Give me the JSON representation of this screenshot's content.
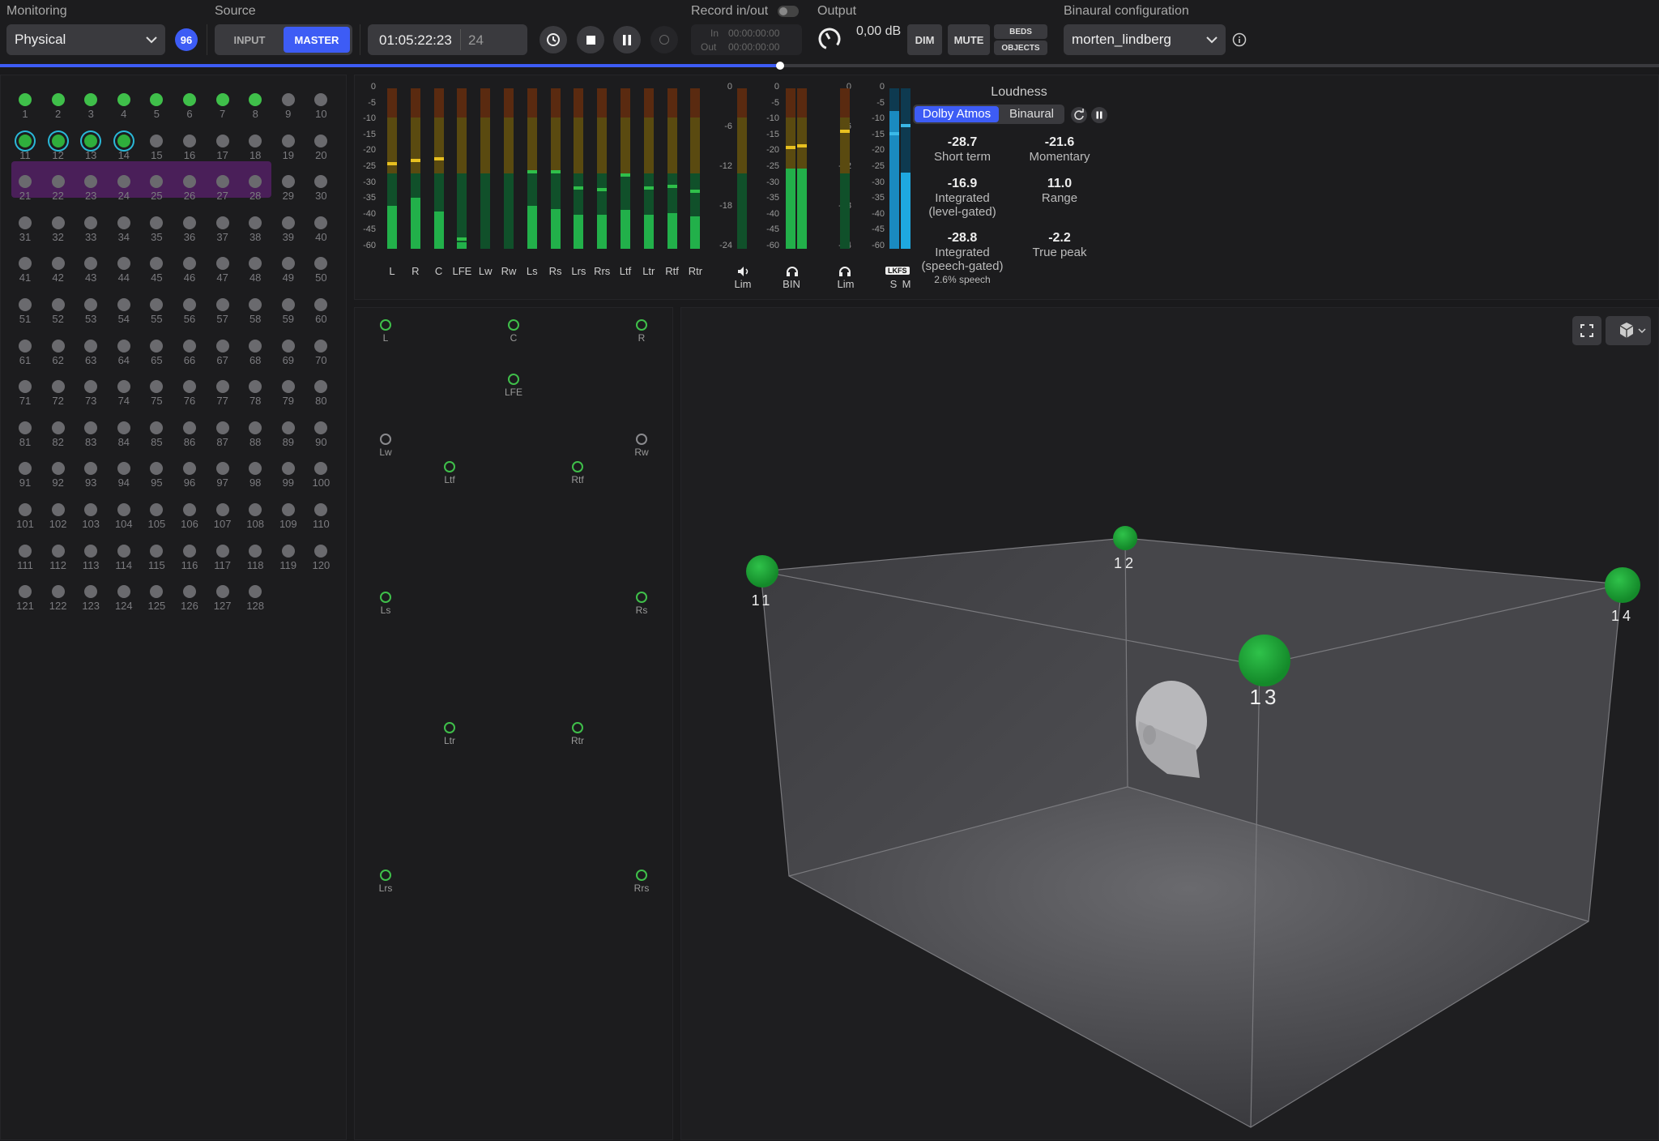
{
  "header": {
    "monitoring_label": "Monitoring",
    "monitoring_value": "Physical",
    "channel_count": "96",
    "source_label": "Source",
    "source_input": "INPUT",
    "source_master": "MASTER",
    "timecode": "01:05:22:23",
    "framerate": "24",
    "record_label": "Record in/out",
    "rec_in_label": "In",
    "rec_in_time": "00:00:00:00",
    "rec_out_label": "Out",
    "rec_out_time": "00:00:00:00",
    "output_label": "Output",
    "output_db": "0,00 dB",
    "dim": "DIM",
    "mute": "MUTE",
    "beds": "BEDS",
    "objects": "OBJECTS",
    "binaural_label": "Binaural configuration",
    "binaural_value": "morten_lindberg"
  },
  "playback_progress": 0.47,
  "channels": {
    "labels": [
      "1",
      "2",
      "3",
      "4",
      "5",
      "6",
      "7",
      "8",
      "9",
      "10",
      "11",
      "12",
      "13",
      "14",
      "15",
      "16",
      "17",
      "18",
      "19",
      "20",
      "21",
      "22",
      "23",
      "24",
      "25",
      "26",
      "27",
      "28",
      "29",
      "30",
      "31",
      "32",
      "33",
      "34",
      "35",
      "36",
      "37",
      "38",
      "39",
      "40",
      "41",
      "42",
      "43",
      "44",
      "45",
      "46",
      "47",
      "48",
      "49",
      "50",
      "51",
      "52",
      "53",
      "54",
      "55",
      "56",
      "57",
      "58",
      "59",
      "60",
      "61",
      "62",
      "63",
      "64",
      "65",
      "66",
      "67",
      "68",
      "69",
      "70",
      "71",
      "72",
      "73",
      "74",
      "75",
      "76",
      "77",
      "78",
      "79",
      "80",
      "81",
      "82",
      "83",
      "84",
      "85",
      "86",
      "87",
      "88",
      "89",
      "90",
      "91",
      "92",
      "93",
      "94",
      "95",
      "96",
      "97",
      "98",
      "99",
      "100",
      "101",
      "102",
      "103",
      "104",
      "105",
      "106",
      "107",
      "108",
      "109",
      "110",
      "111",
      "112",
      "113",
      "114",
      "115",
      "116",
      "117",
      "118",
      "119",
      "120",
      "121",
      "122",
      "123",
      "124",
      "125",
      "126",
      "127",
      "128"
    ],
    "active_bed": [
      1,
      2,
      3,
      4,
      5,
      6,
      7,
      8
    ],
    "active_objects": [
      11,
      12,
      13,
      14
    ]
  },
  "meters": {
    "scale_main": [
      "0",
      "-5",
      "-10",
      "-15",
      "-20",
      "-25",
      "-30",
      "-35",
      "-40",
      "-45",
      "-60"
    ],
    "scale_small": [
      "0",
      "-6",
      "-12",
      "-18",
      "-24"
    ],
    "channels": [
      {
        "label": "L",
        "level": 0.27,
        "peak": 0.52
      },
      {
        "label": "R",
        "level": 0.32,
        "peak": 0.54
      },
      {
        "label": "C",
        "level": 0.23,
        "peak": 0.55
      },
      {
        "label": "LFE",
        "level": 0.04,
        "peak": 0.05
      },
      {
        "label": "Lw",
        "level": 0.0,
        "peak": 0.0
      },
      {
        "label": "Rw",
        "level": 0.0,
        "peak": 0.0
      },
      {
        "label": "Ls",
        "level": 0.27,
        "peak": 0.47
      },
      {
        "label": "Rs",
        "level": 0.25,
        "peak": 0.47
      },
      {
        "label": "Lrs",
        "level": 0.21,
        "peak": 0.37
      },
      {
        "label": "Rrs",
        "level": 0.21,
        "peak": 0.36
      },
      {
        "label": "Ltf",
        "level": 0.24,
        "peak": 0.45
      },
      {
        "label": "Ltr",
        "level": 0.21,
        "peak": 0.37
      },
      {
        "label": "Rtf",
        "level": 0.22,
        "peak": 0.38
      },
      {
        "label": "Rtr",
        "level": 0.2,
        "peak": 0.35
      }
    ],
    "lim_label": "Lim",
    "bin_label": "BIN",
    "lkfs_label": "LKFS",
    "s_label": "S",
    "m_label": "M"
  },
  "loudness": {
    "title": "Loudness",
    "tab_atmos": "Dolby Atmos",
    "tab_binaural": "Binaural",
    "short_term_value": "-28.7",
    "short_term_label": "Short term",
    "momentary_value": "-21.6",
    "momentary_label": "Momentary",
    "integrated_value": "-16.9",
    "integrated_label": "Integrated",
    "integrated_sub": "(level-gated)",
    "range_value": "11.0",
    "range_label": "Range",
    "speech_value": "-28.8",
    "speech_label": "Integrated",
    "speech_sub": "(speech-gated)",
    "speech_pct": "2.6% speech",
    "truepeak_value": "-2.2",
    "truepeak_label": "True peak"
  },
  "speakers": [
    "L",
    "C",
    "R",
    "LFE",
    "Lw",
    "Rw",
    "Ltf",
    "Rtf",
    "Ls",
    "Rs",
    "Ltr",
    "Rtr",
    "Lrs",
    "Rrs"
  ],
  "objects": [
    "11",
    "12",
    "13",
    "14"
  ],
  "colors": {
    "accent": "#3d5cf5",
    "active": "#3fbf4a",
    "group": "#4a1f59",
    "ring": "#2ab8d8"
  }
}
